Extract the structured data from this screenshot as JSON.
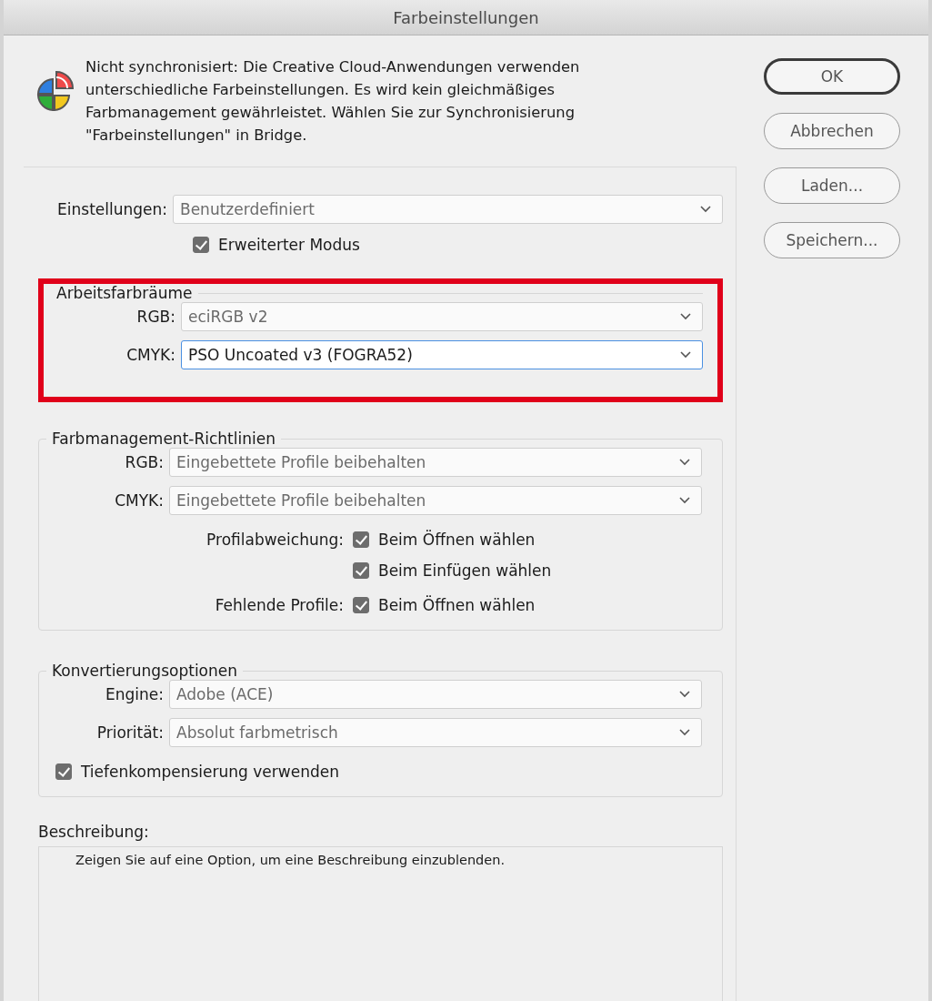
{
  "window": {
    "title": "Farbeinstellungen"
  },
  "message": {
    "lines": [
      "Nicht synchronisiert: Die Creative Cloud-Anwendungen verwenden",
      "unterschiedliche Farbeinstellungen. Es wird kein gleichmäßiges",
      "Farbmanagement gewährleistet. Wählen Sie zur Synchronisierung",
      "\"Farbeinstellungen\" in Bridge."
    ]
  },
  "buttons": [
    {
      "label": "OK",
      "default": true
    },
    {
      "label": "Abbrechen",
      "default": false
    },
    {
      "label": "Laden...",
      "default": false
    },
    {
      "label": "Speichern...",
      "default": false
    }
  ],
  "settings": {
    "label": "Einstellungen:",
    "value": "Benutzerdefiniert",
    "focused": false
  },
  "advanced_mode": {
    "label": "Erweiterter Modus",
    "checked": true
  },
  "working_spaces": {
    "title": "Arbeitsfarbräume",
    "highlighted": true,
    "fields": [
      {
        "label": "RGB:",
        "value": "eciRGB v2",
        "focused": false
      },
      {
        "label": "CMYK:",
        "value": "PSO Uncoated v3 (FOGRA52)",
        "focused": true
      }
    ]
  },
  "policies": {
    "title": "Farbmanagement-Richtlinien",
    "fields": [
      {
        "label": "RGB:",
        "value": "Eingebettete Profile beibehalten",
        "focused": false
      },
      {
        "label": "CMYK:",
        "value": "Eingebettete Profile beibehalten",
        "focused": false
      }
    ],
    "options": [
      {
        "label": "Profilabweichung:",
        "checks": [
          {
            "label": "Beim Öffnen wählen",
            "checked": true
          },
          {
            "label": "Beim Einfügen wählen",
            "checked": true
          }
        ]
      },
      {
        "label": "Fehlende Profile:",
        "checks": [
          {
            "label": "Beim Öffnen wählen",
            "checked": true
          }
        ]
      }
    ]
  },
  "conversion": {
    "title": "Konvertierungsoptionen",
    "fields": [
      {
        "label": "Engine:",
        "value": "Adobe (ACE)",
        "focused": false
      },
      {
        "label": "Priorität:",
        "value": "Absolut farbmetrisch",
        "focused": false
      }
    ],
    "black_point": {
      "label": "Tiefenkompensierung verwenden",
      "checked": true
    }
  },
  "description": {
    "label": "Beschreibung:",
    "text": "Zeigen Sie auf eine Option, um eine Beschreibung einzublenden."
  }
}
